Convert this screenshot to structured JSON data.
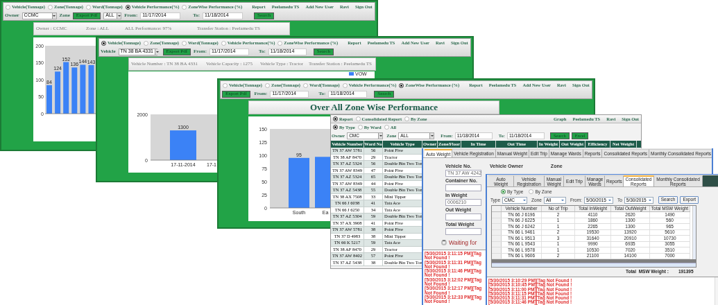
{
  "performance_window": {
    "nav": {
      "options": [
        {
          "label": "Vehicle(Tonnage)",
          "selected": false
        },
        {
          "label": "Zone(Tonnage)",
          "selected": false
        },
        {
          "label": "Ward(Tonnage)",
          "selected": false
        },
        {
          "label": "Vehicle Performance(%)",
          "selected": true
        },
        {
          "label": "ZoneWise Performance (%)",
          "selected": false
        }
      ],
      "links": [
        "Report",
        "Peelamedu TS",
        "Add New User",
        "Ravi",
        "Sign Out"
      ]
    },
    "filters": [
      {
        "kind": "label",
        "text": "Owner"
      },
      {
        "kind": "select",
        "value": "CCMC"
      },
      {
        "kind": "label",
        "text": "Zone"
      },
      {
        "kind": "button",
        "text": "Export Pdf"
      },
      {
        "kind": "select",
        "value": "ALL"
      },
      {
        "kind": "label",
        "text": "From:"
      },
      {
        "kind": "input",
        "value": "11/17/2014"
      },
      {
        "kind": "label",
        "text": "To:"
      },
      {
        "kind": "input",
        "value": "11/18/2014"
      },
      {
        "kind": "button",
        "text": "Search"
      }
    ],
    "info": [
      "Owner : CCMC",
      "Zone : ALL",
      "ALL Performance: 97%",
      "Transfer Station : Peelamedu TS"
    ],
    "chart_data": {
      "type": "bar",
      "values": [
        84,
        124,
        152,
        136,
        144,
        143
      ],
      "ylim": [
        0,
        200
      ],
      "yticks": [
        0,
        50,
        100,
        150,
        200
      ],
      "data_labels": true
    }
  },
  "vehicle_window": {
    "nav": {
      "options": [
        {
          "label": "Vehicle(Tonnage)",
          "selected": true
        },
        {
          "label": "Zone(Tonnage)",
          "selected": false
        },
        {
          "label": "Ward(Tonnage)",
          "selected": false
        },
        {
          "label": "Vehicle Performance(%)",
          "selected": false
        },
        {
          "label": "ZoneWise Performance (%)",
          "selected": false
        }
      ],
      "links": [
        "Report",
        "Peelamedu TS",
        "Add New User",
        "Ravi",
        "Sign Out"
      ]
    },
    "filters": [
      {
        "kind": "label",
        "text": "Vehicle"
      },
      {
        "kind": "select",
        "value": "TN 38 BA 4331"
      },
      {
        "kind": "button",
        "text": "Export Pdf"
      },
      {
        "kind": "label",
        "text": "From:"
      },
      {
        "kind": "input",
        "value": "11/17/2014"
      },
      {
        "kind": "label",
        "text": "To:"
      },
      {
        "kind": "input",
        "value": "11/18/2014"
      },
      {
        "kind": "button",
        "text": "Search"
      }
    ],
    "info": [
      "Vehicle Number : TN 38 BA 4331",
      "Vehicle Capacity : 1275",
      "Vehicle Type : Tractor",
      "Transfer Station : Peelamedu TS"
    ],
    "chart_data": {
      "type": "bar",
      "categories": [
        "17-11-2014",
        "17-1"
      ],
      "series": [
        {
          "name": "VOW",
          "color": "#3b82f6",
          "values": [
            1300,
            null
          ]
        }
      ],
      "ylim": [
        0,
        2000
      ],
      "yticks": [
        0,
        2000
      ],
      "data_labels": true
    }
  },
  "zonewise_window": {
    "nav": {
      "options": [
        {
          "label": "Vehicle(Tonnage)",
          "selected": false
        },
        {
          "label": "Zone(Tonnage)",
          "selected": false
        },
        {
          "label": "Ward(Tonnage)",
          "selected": false
        },
        {
          "label": "Vehicle Performance(%)",
          "selected": false
        },
        {
          "label": "ZoneWise Performance (%)",
          "selected": true
        }
      ],
      "links": [
        "Report",
        "Peelamedu TS",
        "Add New User",
        "Ravi",
        "Sign Out"
      ]
    },
    "filters": [
      {
        "kind": "button",
        "text": "Export Pdf"
      },
      {
        "kind": "label",
        "text": "From:"
      },
      {
        "kind": "input",
        "value": "11/17/2014"
      },
      {
        "kind": "label",
        "text": "To:"
      },
      {
        "kind": "input",
        "value": "11/18/2014"
      },
      {
        "kind": "button",
        "text": "Search"
      }
    ],
    "title": "Over All Zone Wise Performance",
    "chart_data": {
      "type": "bar",
      "categories": [
        "South",
        "Ea"
      ],
      "values": [
        95,
        97
      ],
      "ylim": [
        0,
        150
      ],
      "yticks": [
        0,
        25,
        50,
        75,
        100,
        125,
        150
      ],
      "value_labels": [
        "95",
        null
      ]
    }
  },
  "report_window": {
    "modes": [
      {
        "label": "Report",
        "selected": true
      },
      {
        "label": "Consolidated Report",
        "selected": false
      },
      {
        "label": "By Zone",
        "selected": false
      }
    ],
    "links": [
      "Graph",
      "Peelamedu TS",
      "Ravi",
      "Sign Out"
    ],
    "groupings": [
      {
        "label": "By Type",
        "selected": true
      },
      {
        "label": "By Ward",
        "selected": false
      },
      {
        "label": "All",
        "selected": false
      }
    ],
    "filters": [
      {
        "kind": "label",
        "text": "Owner"
      },
      {
        "kind": "select",
        "value": "CMC"
      },
      {
        "kind": "label",
        "text": "Zone"
      },
      {
        "kind": "select",
        "value": "ALL"
      },
      {
        "kind": "label",
        "text": "From:"
      },
      {
        "kind": "input",
        "value": "11/18/2014"
      },
      {
        "kind": "label",
        "text": "To:"
      },
      {
        "kind": "input",
        "value": "11/18/2014"
      },
      {
        "kind": "button",
        "text": "Search"
      },
      {
        "kind": "button",
        "text": "Excel"
      }
    ],
    "table": {
      "columns": [
        "Vehicle Number",
        "Ward No",
        "Vehicle Type",
        "Owner",
        "Zone/Floor",
        "In Time",
        "Out Time",
        "In Weight",
        "Out Weight",
        "Efficiency",
        "Net Weight"
      ],
      "rows": [
        [
          "TN 37 AW 5781",
          "56",
          "Point Five"
        ],
        [
          "TN 38 AF 8470",
          "29",
          "Tractor"
        ],
        [
          "TN 37 AZ 5324",
          "56",
          "Double Bin Two Ton"
        ],
        [
          "TN 37 AW 8349",
          "47",
          "Point Five"
        ],
        [
          "TN 37 AZ 5324",
          "65",
          "Double Bin Two Ton"
        ],
        [
          "TN 37 AW 8349",
          "44",
          "Point Five"
        ],
        [
          "TN 37 AZ 5438",
          "55",
          "Double Bin Two Ton"
        ],
        [
          "TN 38 AX 7508",
          "33",
          "Mini Tipper"
        ],
        [
          "TN 66 J 6038",
          "41",
          "Tata Ace"
        ],
        [
          "TN 66 J 6250",
          "34",
          "Tata Ace"
        ],
        [
          "TN 37 AZ 5304",
          "59",
          "Double Bin Two Ton"
        ],
        [
          "TN 37 AX 3908",
          "41",
          "Point Five"
        ],
        [
          "TN 37 AW 5781",
          "38",
          "Point Five"
        ],
        [
          "TN 37 D 4983",
          "38",
          "Mini Tipper"
        ],
        [
          "TN 66 K 5217",
          "59",
          "Tata Ace"
        ],
        [
          "TN 38 AF 8470",
          "29",
          "Tractor"
        ],
        [
          "TN 37 AW 8402",
          "57",
          "Point Five"
        ],
        [
          "TN 37 AZ 5438",
          "38",
          "Double Bin Two Ton"
        ]
      ]
    }
  },
  "auto_weight_window": {
    "tabs": [
      {
        "label": "Auto Weight",
        "selected": true
      },
      {
        "label": "Vehicle Registration",
        "selected": false
      },
      {
        "label": "Manual Weight",
        "selected": false
      },
      {
        "label": "Edit Trip",
        "selected": false
      },
      {
        "label": "Manage Wards",
        "selected": false
      },
      {
        "label": "Reports",
        "selected": false
      },
      {
        "label": "Consolidated Reports",
        "selected": false
      },
      {
        "label": "Monthly Consolidated Reports",
        "selected": false
      }
    ],
    "fields": [
      {
        "label": "Vehicle No.",
        "value": "TN 37 AW 4242"
      },
      {
        "label": "Container No."
      },
      {
        "label": "In Weight",
        "value": "0006210"
      },
      {
        "label": "Out Weight"
      },
      {
        "label": "Total Weight"
      }
    ],
    "labels": [
      "Vehicle Owner",
      "Zone"
    ],
    "status": "Waiting for",
    "log": [
      "[5/30/2015 3:11:15 PM][Tag Not Found !",
      "[5/30/2015 3:11:31 PM][Tag Not Found !",
      "[5/30/2015 3:11:46 PM][Tag Not Found !",
      "[5/30/2015 3:12:02 PM][Tag Not Found !",
      "[5/30/2015 3:12:17 PM][Tag Not Found !",
      "[5/30/2015 3:12:33 PM][Tag Not Found !"
    ]
  },
  "consolidated_window": {
    "tabs": [
      {
        "label": "Auto Weight",
        "selected": false
      },
      {
        "label": "Vehicle Registration",
        "selected": false
      },
      {
        "label": "Manual Weight",
        "selected": false
      },
      {
        "label": "Edit Trip",
        "selected": false
      },
      {
        "label": "Manage Wards",
        "selected": false
      },
      {
        "label": "Reports",
        "selected": false
      },
      {
        "label": "Consolidated Reports",
        "selected": true
      },
      {
        "label": "Monthly Consolidated Reports",
        "selected": false
      }
    ],
    "groupings": [
      {
        "label": "By Type",
        "selected": true
      },
      {
        "label": "By Zone",
        "selected": false
      }
    ],
    "filters": [
      {
        "kind": "label",
        "text": "Type"
      },
      {
        "kind": "select",
        "value": "CMC"
      },
      {
        "kind": "label",
        "text": "Zone"
      },
      {
        "kind": "select",
        "value": "All"
      },
      {
        "kind": "label",
        "text": "From:"
      },
      {
        "kind": "select",
        "value": "5/30/2015"
      },
      {
        "kind": "label",
        "text": "To"
      },
      {
        "kind": "select",
        "value": "5/30/2015"
      },
      {
        "kind": "button",
        "text": "Search"
      },
      {
        "kind": "button",
        "text": "Export"
      }
    ],
    "table": {
      "columns": [
        "Vehicle Number",
        "No of Trip",
        "Total InWeight",
        "Total OutWeight",
        "Total MSW Weight"
      ],
      "rows": [
        [
          "TN 66 J 6196",
          "2",
          "4110",
          "2620",
          "1490"
        ],
        [
          "TN 66 J 6225",
          "1",
          "1860",
          "1300",
          "560"
        ],
        [
          "TN 66 J 6242",
          "1",
          "2265",
          "1300",
          "965"
        ],
        [
          "TN 66 L 9461",
          "2",
          "19530",
          "13920",
          "5610"
        ],
        [
          "TN 66 L 9513",
          "3",
          "31640",
          "20910",
          "10730"
        ],
        [
          "TN 66 L 9543",
          "1",
          "9990",
          "6935",
          "3055"
        ],
        [
          "TN 66 L 9578",
          "1",
          "10530",
          "7020",
          "3510"
        ],
        [
          "TN 66 L 9606",
          "2",
          "21100",
          "14100",
          "7000"
        ]
      ]
    },
    "total_label": "Total  MSW Weight :",
    "total_value": "191395",
    "log": [
      "[5/30/2015 3:10:29 PM][Tag Not Found !",
      "[5/30/2015 3:10:45 PM][Tag Not Found !",
      "[5/30/2015 3:11:00 PM][Tag Not Found !",
      "[5/30/2015 3:11:15 PM][Tag Not Found !",
      "[5/30/2015 3:11:31 PM][Tag Not Found !",
      "[5/30/2015 3:11:46 PM][Tag Not Found !"
    ]
  }
}
